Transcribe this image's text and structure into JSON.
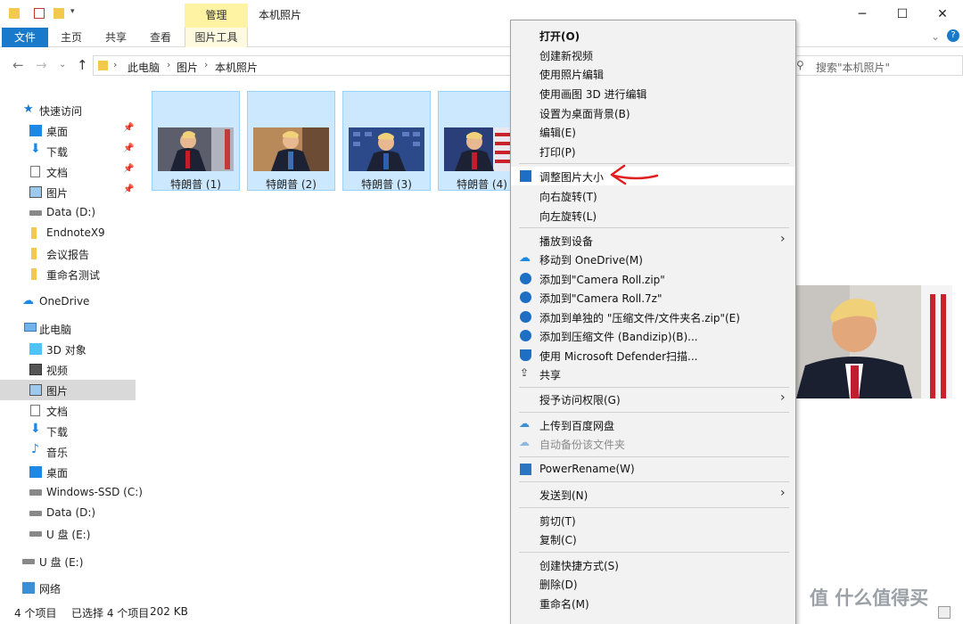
{
  "window": {
    "title": "本机照片",
    "context_tab": "管理",
    "controls": [
      "─",
      "☐",
      "✕"
    ]
  },
  "ribbon": {
    "tabs": [
      "文件",
      "主页",
      "共享",
      "查看",
      "图片工具"
    ]
  },
  "address": {
    "crumbs": [
      "此电脑",
      "图片",
      "本机照片"
    ],
    "search_placeholder": "搜索\"本机照片\""
  },
  "sidebar": {
    "quick_access": "快速访问",
    "quick_items": [
      {
        "label": "桌面",
        "icon": "desktop-icon"
      },
      {
        "label": "下载",
        "icon": "download-icon"
      },
      {
        "label": "文档",
        "icon": "document-icon"
      },
      {
        "label": "图片",
        "icon": "pictures-icon"
      },
      {
        "label": "Data (D:)",
        "icon": "drive-icon"
      },
      {
        "label": "EndnoteX9",
        "icon": "folder-icon"
      },
      {
        "label": "会议报告",
        "icon": "folder-icon"
      },
      {
        "label": "重命名测试",
        "icon": "folder-icon"
      }
    ],
    "onedrive": "OneDrive",
    "this_pc": "此电脑",
    "pc_items": [
      {
        "label": "3D 对象",
        "icon": "3d-objects-icon"
      },
      {
        "label": "视频",
        "icon": "video-icon"
      },
      {
        "label": "图片",
        "icon": "pictures-icon"
      },
      {
        "label": "文档",
        "icon": "document-icon"
      },
      {
        "label": "下载",
        "icon": "download-icon"
      },
      {
        "label": "音乐",
        "icon": "music-icon"
      },
      {
        "label": "桌面",
        "icon": "desktop-icon"
      },
      {
        "label": "Windows-SSD (C:)",
        "icon": "windows-drive-icon"
      },
      {
        "label": "Data (D:)",
        "icon": "drive-icon"
      },
      {
        "label": "U 盘 (E:)",
        "icon": "usb-drive-icon"
      }
    ],
    "usb": "U 盘 (E:)",
    "network": "网络"
  },
  "files": [
    {
      "name": "特朗普 (1)"
    },
    {
      "name": "特朗普 (2)"
    },
    {
      "name": "特朗普 (3)"
    },
    {
      "name": "特朗普 (4)"
    }
  ],
  "status": {
    "count": "4 个项目",
    "selection": "已选择 4 个项目",
    "size": "202 KB"
  },
  "context_menu": {
    "groups": [
      [
        {
          "label": "打开(O)",
          "bold": true
        },
        {
          "label": "创建新视频"
        },
        {
          "label": "使用照片编辑"
        },
        {
          "label": "使用画图 3D 进行编辑"
        },
        {
          "label": "设置为桌面背景(B)"
        },
        {
          "label": "编辑(E)"
        },
        {
          "label": "打印(P)"
        }
      ],
      [
        {
          "label": "调整图片大小",
          "icon": "resize-image-icon",
          "highlight": true
        },
        {
          "label": "向右旋转(T)"
        },
        {
          "label": "向左旋转(L)"
        }
      ],
      [
        {
          "label": "播放到设备",
          "submenu": true
        },
        {
          "label": "移动到 OneDrive(M)",
          "icon": "onedrive-icon"
        },
        {
          "label": "添加到\"Camera Roll.zip\"",
          "icon": "bandizip-icon"
        },
        {
          "label": "添加到\"Camera Roll.7z\"",
          "icon": "bandizip-icon"
        },
        {
          "label": "添加到单独的 \"压缩文件/文件夹名.zip\"(E)",
          "icon": "bandizip-icon"
        },
        {
          "label": "添加到压缩文件 (Bandizip)(B)...",
          "icon": "bandizip-icon"
        },
        {
          "label": "使用 Microsoft Defender扫描...",
          "icon": "defender-shield-icon"
        },
        {
          "label": "共享",
          "icon": "share-icon"
        }
      ],
      [
        {
          "label": "授予访问权限(G)",
          "submenu": true
        }
      ],
      [
        {
          "label": "上传到百度网盘",
          "icon": "baidu-cloud-icon"
        },
        {
          "label": "自动备份该文件夹",
          "icon": "baidu-cloud-icon",
          "disabled": true
        }
      ],
      [
        {
          "label": "PowerRename(W)",
          "icon": "powerrename-icon"
        }
      ],
      [
        {
          "label": "发送到(N)",
          "submenu": true
        }
      ],
      [
        {
          "label": "剪切(T)"
        },
        {
          "label": "复制(C)"
        }
      ],
      [
        {
          "label": "创建快捷方式(S)"
        },
        {
          "label": "删除(D)"
        },
        {
          "label": "重命名(M)"
        }
      ]
    ]
  },
  "watermark": "值 什么值得买",
  "colors": {
    "accent": "#1979ca",
    "selection": "#cce8ff",
    "context_tab": "#fdf3a3",
    "annotation_arrow": "#e02020"
  }
}
